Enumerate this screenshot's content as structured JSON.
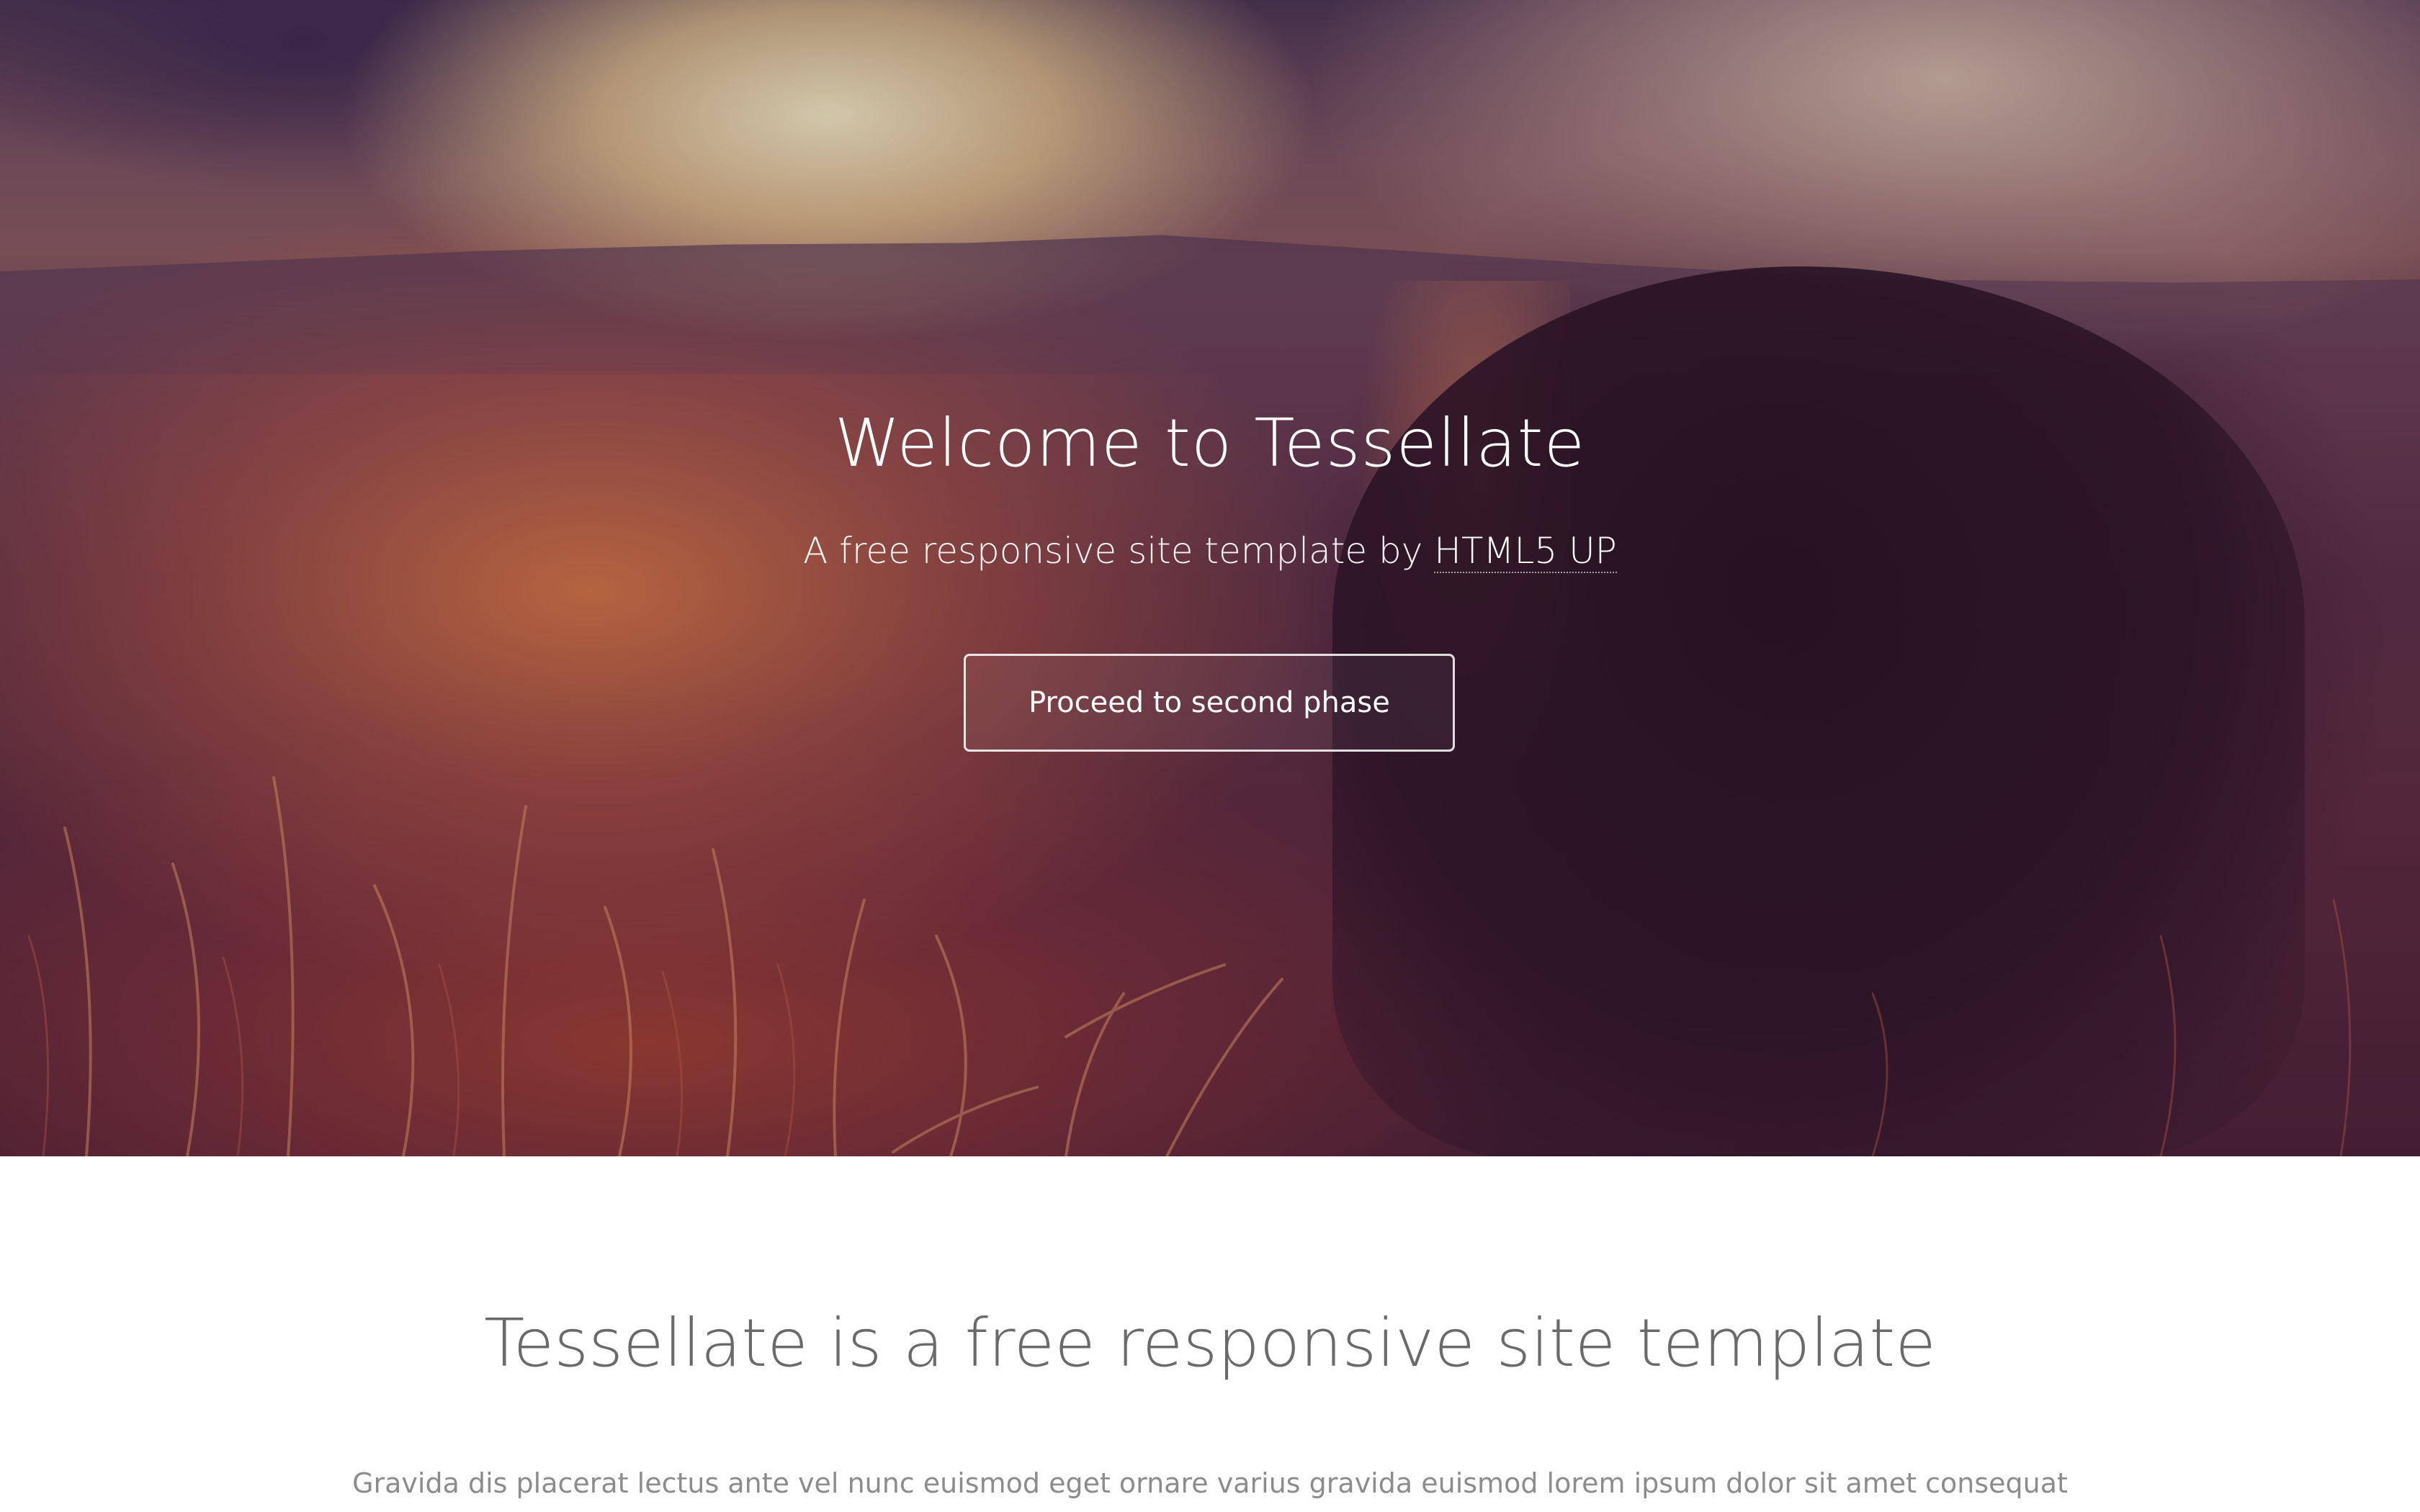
{
  "hero": {
    "title": "Welcome to Tessellate",
    "subtitle_prefix": "A free responsive site template by ",
    "subtitle_link": "HTML5 UP",
    "button_label": "Proceed to second phase"
  },
  "intro": {
    "title": "Tessellate is a free responsive site template",
    "text": "Gravida dis placerat lectus ante vel nunc euismod eget ornare varius gravida euismod lorem ipsum dolor sit amet consequat"
  },
  "colors": {
    "hero_text": "#ffffff",
    "content_title": "#6a6a6a",
    "content_text": "#8c8c8c",
    "content_background": "#ffffff"
  }
}
